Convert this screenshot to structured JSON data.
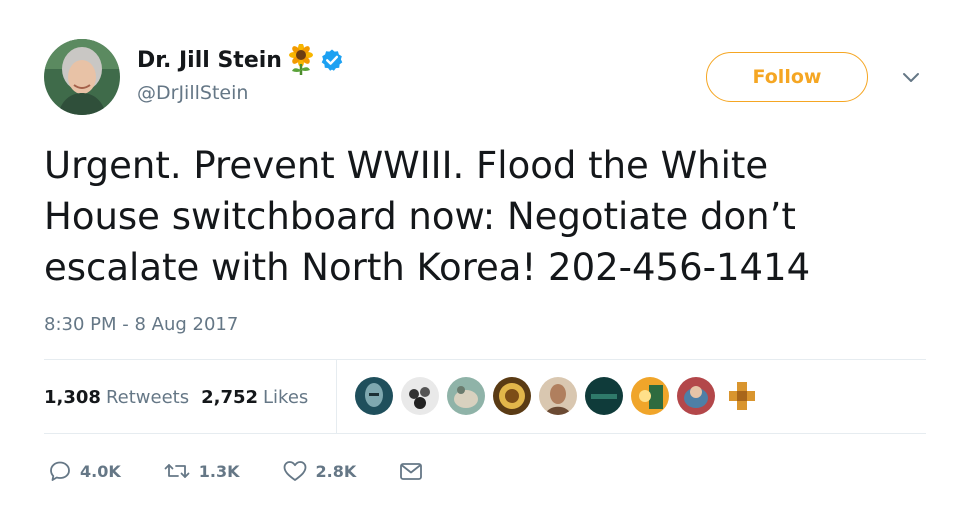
{
  "author": {
    "display_name": "Dr. Jill Stein",
    "handle": "@DrJillStein",
    "name_emoji": "sunflower-icon",
    "verified": true
  },
  "follow_button": {
    "label": "Follow"
  },
  "tweet": {
    "text": "Urgent. Prevent WWIII. Flood the White\nHouse switchboard now: Negotiate don’t\nescalate with North Korea! 202-456-1414",
    "timestamp": "8:30 PM - 8 Aug 2017"
  },
  "stats": {
    "retweets_count": "1,308",
    "retweets_label": "Retweets",
    "likes_count": "2,752",
    "likes_label": "Likes"
  },
  "actions": {
    "reply_count": "4.0K",
    "retweet_count": "1.3K",
    "like_count": "2.8K"
  },
  "colors": {
    "follow_accent": "#f5a623",
    "verified_blue": "#1da1f2",
    "muted_text": "#657786",
    "primary_text": "#14171a",
    "divider": "#e6ecf0"
  }
}
